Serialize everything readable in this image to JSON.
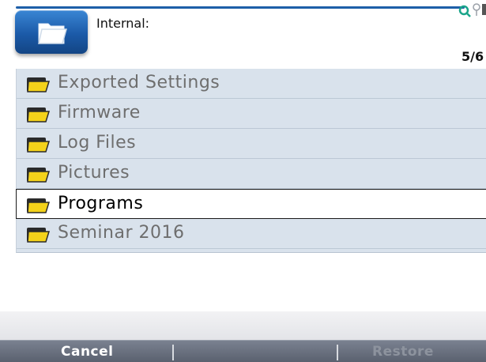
{
  "header": {
    "location_label": "Internal:",
    "page_counter": "5/6"
  },
  "list": {
    "items": [
      {
        "label": "Exported Settings",
        "selected": false
      },
      {
        "label": "Firmware",
        "selected": false
      },
      {
        "label": "Log Files",
        "selected": false
      },
      {
        "label": "Pictures",
        "selected": false
      },
      {
        "label": "Programs",
        "selected": true
      },
      {
        "label": "Seminar 2016",
        "selected": false
      }
    ]
  },
  "softkeys": {
    "cancel_label": "Cancel",
    "restore_label": "Restore"
  },
  "colors": {
    "accent_blue": "#1d5fa8",
    "list_background": "#d9e2ec",
    "folder_yellow": "#f4d21a",
    "softkey_bar": "#5a616f"
  },
  "icons": {
    "header_button": "open-folder-icon",
    "row_icon": "folder-icon",
    "top_right": "search-icon"
  }
}
